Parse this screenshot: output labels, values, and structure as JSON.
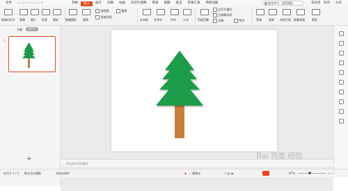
{
  "menubar": {
    "items": [
      "文件",
      "开始",
      "插入",
      "设计",
      "切换",
      "动画",
      "幻灯片放映",
      "审阅",
      "视图",
      "安全",
      "开发工具",
      "特色功能"
    ],
    "active_index": 2,
    "search_placeholder": "查找命令、搜索模板",
    "right": [
      "未同步",
      "协作",
      "分享"
    ]
  },
  "toolbar": {
    "new_slide": "新建幻灯片",
    "table": "表格",
    "picture": "图片",
    "shape": "形状",
    "icon": "图标",
    "smartart": "智能图形",
    "chart": "图表",
    "flowchart": "流程图",
    "mindmap": "思维导图",
    "screenshot": "截屏",
    "textbox": "文本框",
    "artword": "艺术字",
    "symbol": "符号",
    "formula": "公式",
    "header_footer": "页眉页脚",
    "date_time": "日期和时间",
    "slide_number": "幻灯片编号",
    "object": "对象",
    "attachment": "附件",
    "audio": "音频",
    "video": "视频",
    "doc_ref": "文档引用",
    "screen_record": "屏幕录制",
    "more": "更多"
  },
  "left_panel": {
    "tab_outline": "大纲",
    "tab_slides": "幻灯片",
    "slide_number": "1",
    "add_label": "+"
  },
  "notes_placeholder": "单击此处添加备注",
  "statusbar": {
    "slide_info": "幻灯片 1 / 1",
    "theme": "默认设计模板",
    "doc_status": "文档未保护",
    "beautify": "一键美化",
    "zoom": "87%"
  },
  "watermark": "Bai 百度 经验",
  "colors": {
    "accent": "#e8461f",
    "tree_green": "#1a9d4a",
    "trunk": "#c97f3a"
  }
}
